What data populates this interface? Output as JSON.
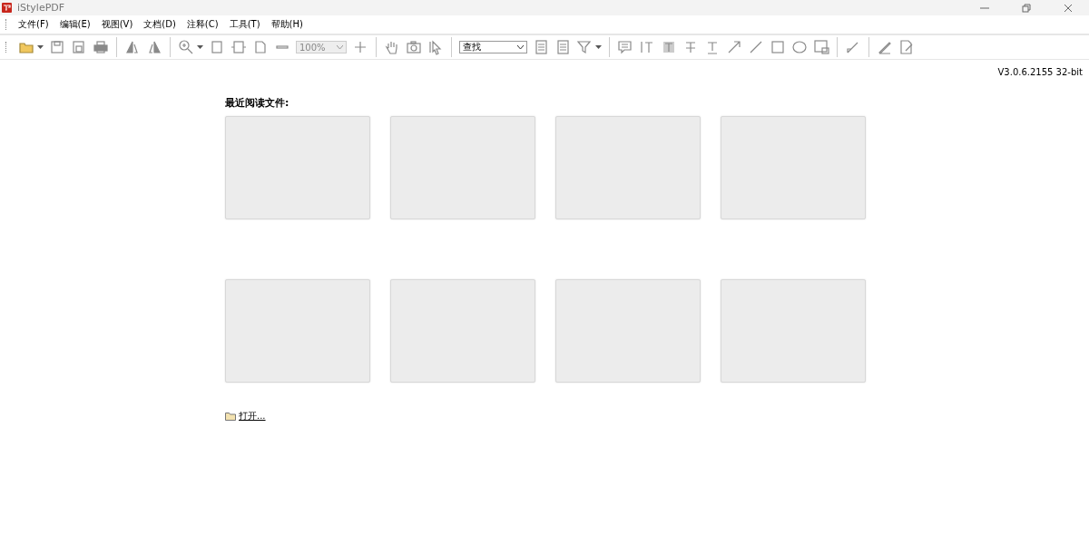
{
  "window": {
    "title": "iStylePDF"
  },
  "menu": [
    "文件(F)",
    "编辑(E)",
    "视图(V)",
    "文档(D)",
    "注释(C)",
    "工具(T)",
    "帮助(H)"
  ],
  "toolbar": {
    "zoom": {
      "value": "100%",
      "disabled": true
    },
    "search": {
      "value": "查找"
    }
  },
  "version": "V3.0.6.2155 32-bit",
  "recent": {
    "heading": "最近阅读文件:",
    "files": [
      {
        "kind": "empty"
      },
      {
        "kind": "empty"
      },
      {
        "kind": "empty"
      },
      {
        "kind": "empty"
      },
      {
        "kind": "empty"
      },
      {
        "kind": "empty"
      },
      {
        "kind": "empty"
      },
      {
        "kind": "empty"
      }
    ]
  },
  "open_link": "打开..."
}
